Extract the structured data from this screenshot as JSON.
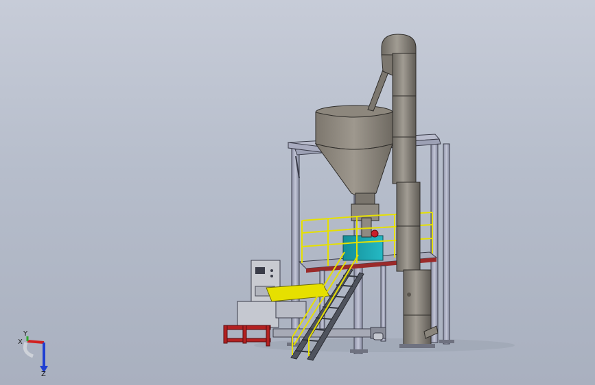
{
  "viewport": {
    "background_top": "#c7ccd8",
    "background_bottom": "#a9b0bf"
  },
  "model": {
    "components": [
      "bucket-elevator",
      "storage-hopper",
      "steel-support-frame",
      "inclined-feed-chute",
      "platform-with-yellow-handrails",
      "access-stairs",
      "teal-weighing-unit",
      "red-motor",
      "electrical-control-cabinet",
      "yellow-bag-conveyor-head",
      "red-bag-conveyor-frame"
    ],
    "colors": {
      "steel": "#8e8a82",
      "frame": "#a9acc0",
      "handrail": "#e6e000",
      "teal_unit": "#1ca8b3",
      "motor": "#c8202a",
      "conveyor": "#b32020",
      "platform_trim": "#9a2a2a"
    }
  },
  "triad": {
    "x_label": "X",
    "y_label": "Y",
    "z_label": "Z",
    "x_color": "#d21f1f",
    "y_color": "#2eaa2e",
    "z_color": "#1f3fd2"
  }
}
